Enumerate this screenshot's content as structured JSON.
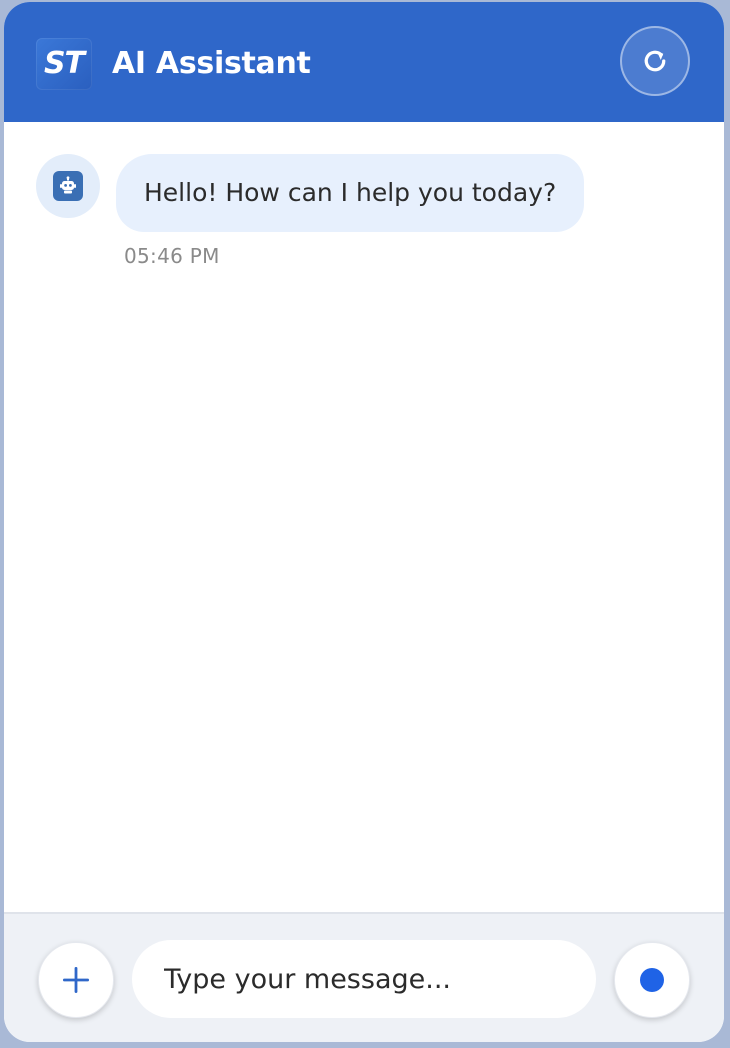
{
  "header": {
    "logo_text": "ST",
    "title": "AI Assistant",
    "refresh_icon": "refresh-icon"
  },
  "messages": [
    {
      "sender": "bot",
      "avatar_icon": "robot-icon",
      "text": "Hello! How can I help you today?",
      "time": "05:46 PM"
    }
  ],
  "composer": {
    "attach_icon": "plus-icon",
    "placeholder": "Type your message...",
    "value": "",
    "record_icon": "record-dot-icon"
  },
  "colors": {
    "header_bg": "#2f67c9",
    "bubble_bg": "#e7f0fd",
    "accent": "#1f63e6",
    "footer_bg": "#eef1f6"
  }
}
